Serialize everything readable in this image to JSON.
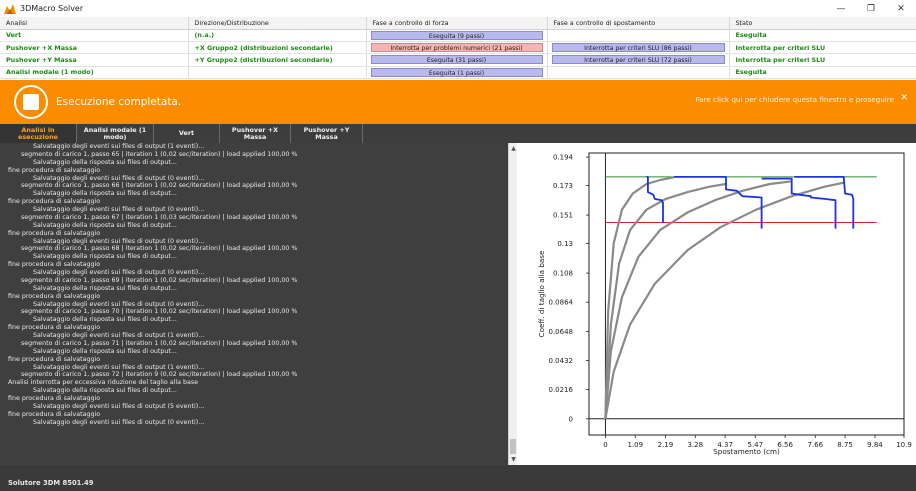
{
  "window": {
    "title": "3DMacro Solver",
    "minimize": "—",
    "maximize": "❐",
    "close": "✕"
  },
  "summary": {
    "headers": [
      "Analisi",
      "Direzione/Distribuzione",
      "Fase a controllo di forza",
      "Fase a controllo di spostamento",
      "Stato"
    ],
    "rows": [
      {
        "name": "Vert",
        "dist": "(n.a.)",
        "force": "Eseguita (9 passi)",
        "force_error": false,
        "disp": "",
        "stato": "Eseguita"
      },
      {
        "name": "Pushover +X Massa",
        "dist": "+X Gruppo2 (distribuzioni secondarie)",
        "force": "Interrotta per problemi numerici (21 passi)",
        "force_error": true,
        "disp": "Interrotta per criteri SLU (86 passi)",
        "stato": "Interrotta per criteri SLU"
      },
      {
        "name": "Pushover +Y Massa",
        "dist": "+Y Gruppo2 (distribuzioni secondarie)",
        "force": "Eseguita (31 passi)",
        "force_error": false,
        "disp": "Interrotta per criteri SLU (72 passi)",
        "stato": "Interrotta per criteri SLU"
      },
      {
        "name": "Analisi modale (1 modo)",
        "dist": "",
        "force": "Eseguita (1 passi)",
        "force_error": false,
        "disp": "",
        "stato": "Eseguita"
      }
    ]
  },
  "banner": {
    "message": "Esecuzione completata.",
    "close_hint": "Fare click qui per chiudere questa finestra e proseguire",
    "close_glyph": "✕"
  },
  "tabs": [
    "Analisi in esecuzione",
    "Analisi modale (1 modo)",
    "Vert",
    "Pushover +X Massa",
    "Pushover +Y Massa"
  ],
  "log": [
    {
      "t": "Salvataggio degli eventi sui files di output (1 eventi)...",
      "i": 2
    },
    {
      "t": "segmento di carico 1, passo 65 | iteration 1 (0,02 sec/iteration) | load applied 100,00 %",
      "i": 1
    },
    {
      "t": "Salvataggio della risposta sui files di output...",
      "i": 2
    },
    {
      "t": "fine procedura di salvataggio",
      "i": 0
    },
    {
      "t": "Salvataggio degli eventi sui files di output (0 eventi)...",
      "i": 2
    },
    {
      "t": "segmento di carico 1, passo 66 | iteration 1 (0,02 sec/iteration) | load applied 100,00 %",
      "i": 1
    },
    {
      "t": "Salvataggio della risposta sui files di output...",
      "i": 2
    },
    {
      "t": "fine procedura di salvataggio",
      "i": 0
    },
    {
      "t": "Salvataggio degli eventi sui files di output (0 eventi)...",
      "i": 2
    },
    {
      "t": "segmento di carico 1, passo 67 | iteration 1 (0,03 sec/iteration) | load applied 100,00 %",
      "i": 1
    },
    {
      "t": "Salvataggio della risposta sui files di output...",
      "i": 2
    },
    {
      "t": "fine procedura di salvataggio",
      "i": 0
    },
    {
      "t": "Salvataggio degli eventi sui files di output (0 eventi)...",
      "i": 2
    },
    {
      "t": "segmento di carico 1, passo 68 | iteration 1 (0,02 sec/iteration) | load applied 100,00 %",
      "i": 1
    },
    {
      "t": "Salvataggio della risposta sui files di output...",
      "i": 2
    },
    {
      "t": "fine procedura di salvataggio",
      "i": 0
    },
    {
      "t": "Salvataggio degli eventi sui files di output (0 eventi)...",
      "i": 2
    },
    {
      "t": "segmento di carico 1, passo 69 | iteration 1 (0,02 sec/iteration) | load applied 100,00 %",
      "i": 1
    },
    {
      "t": "Salvataggio della risposta sui files di output...",
      "i": 2
    },
    {
      "t": "fine procedura di salvataggio",
      "i": 0
    },
    {
      "t": "Salvataggio degli eventi sui files di output (0 eventi)...",
      "i": 2
    },
    {
      "t": "segmento di carico 1, passo 70 | iteration 1 (0,02 sec/iteration) | load applied 100,00 %",
      "i": 1
    },
    {
      "t": "Salvataggio della risposta sui files di output...",
      "i": 2
    },
    {
      "t": "fine procedura di salvataggio",
      "i": 0
    },
    {
      "t": "Salvataggio degli eventi sui files di output (1 eventi)...",
      "i": 2
    },
    {
      "t": "segmento di carico 1, passo 71 | iteration 1 (0,02 sec/iteration) | load applied 100,00 %",
      "i": 1
    },
    {
      "t": "Salvataggio della risposta sui files di output...",
      "i": 2
    },
    {
      "t": "fine procedura di salvataggio",
      "i": 0
    },
    {
      "t": "Salvataggio degli eventi sui files di output (1 eventi)...",
      "i": 2
    },
    {
      "t": "segmento di carico 1, passo 72 | iteration 9 (0,02 sec/iteration) | load applied 100,00 %",
      "i": 1
    },
    {
      "t": "Analisi interrotta per eccessiva riduzione del taglio alla base",
      "i": 0
    },
    {
      "t": "Salvataggio della risposta sui files di output...",
      "i": 2
    },
    {
      "t": "fine procedura di salvataggio",
      "i": 0
    },
    {
      "t": "Salvataggio degli eventi sui files di output (5 eventi)...",
      "i": 2
    },
    {
      "t": "fine procedura di salvataggio",
      "i": 0
    },
    {
      "t": "Salvataggio degli eventi sui files di output (0 eventi)...",
      "i": 2
    }
  ],
  "scroll": {
    "up": "▲",
    "down": "▼"
  },
  "chart_data": {
    "type": "line",
    "xlabel": "Spostamento (cm)",
    "ylabel": "Coeff. di taglio alla base",
    "xlim": [
      -0.6,
      10.9
    ],
    "ylim": [
      -0.012,
      0.197
    ],
    "xticks": [
      "0",
      "1.09",
      "2.19",
      "3.28",
      "4.37",
      "5.47",
      "6.56",
      "7.66",
      "8.75",
      "9.84",
      "10.9"
    ],
    "yticks": [
      "0",
      "0.0216",
      "0.0432",
      "0.0648",
      "0.0864",
      "0.108",
      "0.13",
      "0.151",
      "0.173",
      "0.194"
    ],
    "grid": false,
    "reference_lines": [
      {
        "y": 0.1793,
        "color": "#2e8b2e"
      },
      {
        "y": 0.1455,
        "color": "#e02020"
      }
    ],
    "series": [
      {
        "color": "#8a8a8a",
        "x": [
          0,
          0.1,
          0.3,
          0.6,
          1.0,
          1.5,
          2.0,
          2.5
        ],
        "y": [
          0,
          0.08,
          0.13,
          0.155,
          0.167,
          0.174,
          0.177,
          0.179
        ]
      },
      {
        "color": "#8a8a8a",
        "x": [
          0,
          0.2,
          0.5,
          0.9,
          1.5,
          2.2,
          3.0,
          3.8,
          4.4
        ],
        "y": [
          0,
          0.07,
          0.115,
          0.14,
          0.155,
          0.163,
          0.168,
          0.172,
          0.174
        ]
      },
      {
        "color": "#8a8a8a",
        "x": [
          0,
          0.2,
          0.6,
          1.2,
          2.0,
          3.0,
          4.0,
          5.0,
          6.0,
          6.8
        ],
        "y": [
          0,
          0.05,
          0.09,
          0.12,
          0.14,
          0.153,
          0.162,
          0.169,
          0.174,
          0.176
        ]
      },
      {
        "color": "#8a8a8a",
        "x": [
          0,
          0.3,
          0.9,
          1.8,
          3.0,
          4.2,
          5.5,
          6.8,
          8.0,
          8.7
        ],
        "y": [
          0,
          0.035,
          0.07,
          0.1,
          0.125,
          0.142,
          0.155,
          0.165,
          0.172,
          0.175
        ]
      },
      {
        "color": "#1a33e6",
        "x": [
          1.5,
          1.55,
          1.55,
          1.75,
          1.8,
          2.05,
          2.1,
          2.1
        ],
        "y": [
          0.1793,
          0.1793,
          0.168,
          0.166,
          0.163,
          0.162,
          0.16,
          0.1455
        ]
      },
      {
        "color": "#1a33e6",
        "x": [
          2.5,
          2.55,
          3.9,
          4.4,
          4.4,
          4.8,
          5.0,
          5.7,
          5.7
        ],
        "y": [
          0.1793,
          0.1793,
          0.1793,
          0.1793,
          0.17,
          0.169,
          0.165,
          0.164,
          0.141
        ]
      },
      {
        "color": "#1a33e6",
        "x": [
          5.7,
          6.8,
          6.8,
          7.1,
          7.5,
          7.5,
          8.0,
          8.4,
          8.4
        ],
        "y": [
          0.178,
          0.178,
          0.167,
          0.166,
          0.165,
          0.164,
          0.163,
          0.162,
          0.141
        ]
      },
      {
        "color": "#1a33e6",
        "x": [
          6.9,
          7.6,
          7.65,
          8.7,
          8.75,
          9.0,
          9.05,
          9.05
        ],
        "y": [
          0.1793,
          0.1793,
          0.1793,
          0.1793,
          0.167,
          0.166,
          0.163,
          0.141
        ]
      }
    ]
  },
  "statusbar": {
    "text": "Solutore 3DM 8501.49"
  }
}
